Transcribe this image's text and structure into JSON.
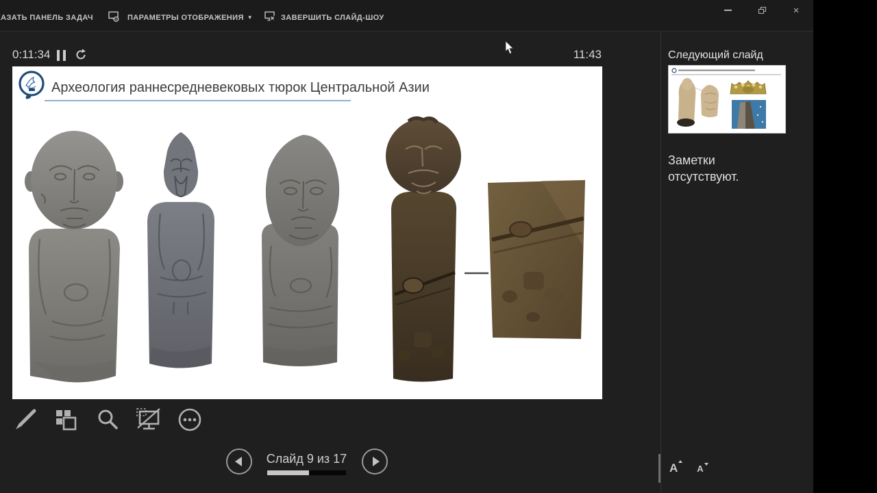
{
  "topbar": {
    "show_taskbar_label": "КАЗАТЬ ПАНЕЛЬ ЗАДАЧ",
    "display_options_label": "ПАРАМЕТРЫ ОТОБРАЖЕНИЯ",
    "display_options_caret": "▼",
    "end_slideshow_label": "ЗАВЕРШИТЬ СЛАЙД-ШОУ",
    "window": {
      "close_glyph": "×"
    }
  },
  "timer": {
    "elapsed": "0:11:34",
    "current_time": "11:43"
  },
  "slide": {
    "title": "Археология раннесредневековых тюрок Центральной Азии",
    "images": [
      {
        "name": "grey-stone-statue-round-head"
      },
      {
        "name": "grey-stone-statue-pointed-cap"
      },
      {
        "name": "grey-stone-statue-bearded"
      },
      {
        "name": "dark-brown-stele-figure"
      },
      {
        "name": "brown-stele-fragment"
      }
    ]
  },
  "navigation": {
    "slide_counter": "Слайд 9 из 17",
    "progress_percent": 53
  },
  "sidebar": {
    "next_slide_header": "Следующий слайд",
    "notes_placeholder": "Заметки отсутствуют.",
    "font_increase_label": "A",
    "font_decrease_label": "A"
  },
  "colors": {
    "slide_background": "#ffffff",
    "app_background": "#1f1f1f",
    "topbar_background": "#1b1b1b",
    "title_underline": "#8fb0d1",
    "logo_blue": "#1f4e79"
  }
}
